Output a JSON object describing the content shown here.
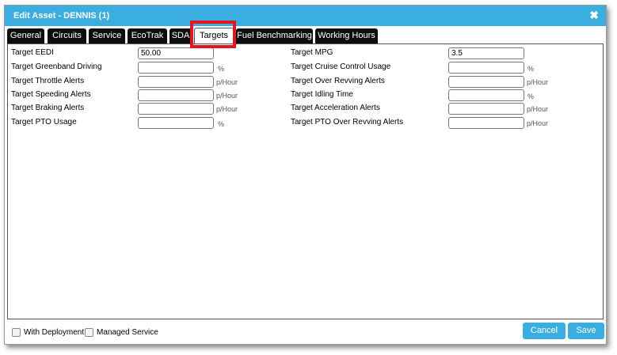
{
  "dialog": {
    "title": "Edit Asset - DENNIS (1)",
    "close_glyph": "✖"
  },
  "tabs": [
    {
      "label": "General"
    },
    {
      "label": "Circuits"
    },
    {
      "label": "Service"
    },
    {
      "label": "EcoTrak"
    },
    {
      "label": "SDA"
    },
    {
      "label": "Targets",
      "active": true
    },
    {
      "label": "Fuel Benchmarking"
    },
    {
      "label": "Working Hours"
    }
  ],
  "left_fields": [
    {
      "label": "Target EEDI",
      "value": "50.00",
      "unit": ""
    },
    {
      "label": "Target Greenband Driving",
      "value": "",
      "unit": "%"
    },
    {
      "label": "Target Throttle Alerts",
      "value": "",
      "unit": "p/Hour"
    },
    {
      "label": "Target Speeding Alerts",
      "value": "",
      "unit": "p/Hour"
    },
    {
      "label": "Target Braking Alerts",
      "value": "",
      "unit": "p/Hour"
    },
    {
      "label": "Target PTO Usage",
      "value": "",
      "unit": "%"
    }
  ],
  "right_fields": [
    {
      "label": "Target MPG",
      "value": "3.5",
      "unit": ""
    },
    {
      "label": "Target Cruise Control Usage",
      "value": "",
      "unit": "%"
    },
    {
      "label": "Target Over Revving Alerts",
      "value": "",
      "unit": "p/Hour"
    },
    {
      "label": "Target Idling Time",
      "value": "",
      "unit": "%"
    },
    {
      "label": "Target Acceleration Alerts",
      "value": "",
      "unit": "p/Hour"
    },
    {
      "label": "Target PTO Over Revving Alerts",
      "value": "",
      "unit": "p/Hour"
    }
  ],
  "footer": {
    "with_deployment": "With Deployment",
    "managed_service": "Managed Service",
    "cancel": "Cancel",
    "save": "Save"
  },
  "colors": {
    "accent": "#3aaee0",
    "tab_bg": "#0d0d0d",
    "highlight": "#e8141c"
  }
}
